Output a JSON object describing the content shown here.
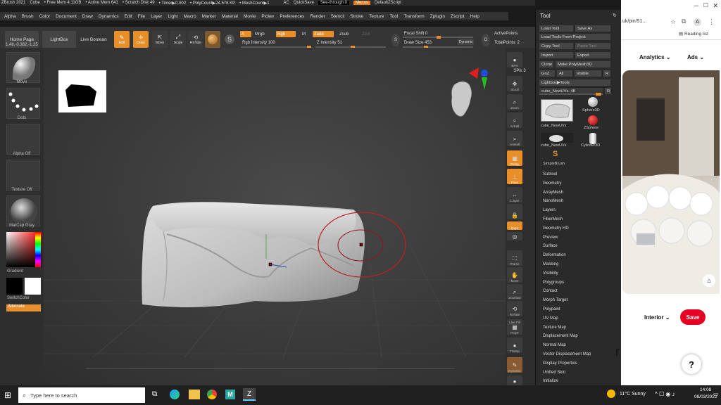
{
  "titlebar": {
    "app": "ZBrush 2021",
    "doc": "Cube",
    "free_mem": "• Free Mem 4.11GB",
    "active_mem": "• Active Mem 641",
    "scratch": "• Scratch Disk 49",
    "timer": "• Timer▶0.002",
    "polycount": "• PolyCount▶24.576 KP",
    "meshcount": "• MeshCount▶1",
    "ac": "AC",
    "quicksave": "QuickSave",
    "seethrough": "See-through  0",
    "menus": "Menus",
    "script": "DefaultZScript"
  },
  "menubar": [
    "Alpha",
    "Brush",
    "Color",
    "Document",
    "Draw",
    "Dynamics",
    "Edit",
    "File",
    "Layer",
    "Light",
    "Macro",
    "Marker",
    "Material",
    "Movie",
    "Picker",
    "Preferences",
    "Render",
    "Stencil",
    "Stroke",
    "Texture",
    "Tool",
    "Transform",
    "Zplugin",
    "Zscript",
    "Help"
  ],
  "toolbar": {
    "home_page": "Home Page",
    "lightbox": "LightBox",
    "live_boolean": "Live Boolean",
    "edit": "Edit",
    "draw": "Draw",
    "move": "Move",
    "scale": "Scale",
    "rotate": "RoTate",
    "a": "A",
    "mrgb": "Mrgb",
    "rgb": "Rgb",
    "m": "M",
    "zadd": "Zadd",
    "zsub": "Zsub",
    "zcut": "Zcut",
    "rgb_intensity": "Rgb Intensity 100",
    "z_intensity": "Z Intensity 51",
    "focal_shift": "Focal Shift 0",
    "draw_size": "Draw Size 453",
    "dynamic": "Dynamic",
    "active_points": "ActivePoints:",
    "total_points": "TotalPoints: 2",
    "s_label": "S",
    "d_label": "D"
  },
  "coords": "1.48,-0.382,-1.25",
  "leftshelf": {
    "move": "Move",
    "dots": "Dots",
    "alpha_off": "Alpha Off",
    "texture_off": "Texture Off",
    "matcap": "MatCap Gray",
    "gradient": "Gradient",
    "switchcolor": "SwitchColor",
    "alternate": "Alternate"
  },
  "rightshelf": {
    "bpr": "BPR",
    "spix": "SPix 3",
    "scroll": "Scroll",
    "zoom": "Zoom",
    "actual": "Actual",
    "aahalf": "AAHalf",
    "persp": "Persp",
    "floor": "Floor",
    "lsym": "L.Sym",
    "local": "",
    "xyz": "Qxyz",
    "frame": "Frame",
    "move": "Move",
    "zoom3d": "Zoom3D",
    "rotate": "RoTate",
    "linefill": "Line Fill",
    "polyf": "PolyF",
    "transp": "Transp",
    "dynamic": "Dynamic",
    "solo": "Solo"
  },
  "toolpanel": {
    "title": "Tool",
    "load_tool": "Load Tool",
    "save_as": "Save As",
    "load_from_project": "Load Tools From Project",
    "copy_tool": "Copy Tool",
    "paste_tool": "Paste Tool",
    "import": "Import",
    "export": "Export",
    "clone": "Clone",
    "make_polymesh": "Make PolyMesh3D",
    "goz": "GoZ",
    "all": "All",
    "visible": "Visible",
    "r": "R",
    "lightbox_tools": "Lightbox▶Tools",
    "cube_newuvs_slider": "cube_NewUVs. 48",
    "thumbs": {
      "cube_newuvs": "cube_NewUVs",
      "sphere3d": "Sphere3D",
      "zsphere": "ZSphere",
      "cube_newuvs2": "cube_NewUVs",
      "cylinder3d": "Cylinder3D",
      "simplebrush": "SimpleBrush"
    },
    "subpalettes": [
      "Subtool",
      "Geometry",
      "ArrayMesh",
      "NanoMesh",
      "Layers",
      "FiberMesh",
      "Geometry HD",
      "Preview",
      "Surface",
      "Deformation",
      "Masking",
      "Visibility",
      "Polygroups",
      "Contact",
      "Morph Target",
      "Polypaint",
      "UV Map",
      "Texture Map",
      "Displacement Map",
      "Normal Map",
      "Vector Displacement Map",
      "Display Properties",
      "Unified Skin",
      "Initialize"
    ]
  },
  "browser": {
    "url": ".uk/pin/51...",
    "reading_list": "Reading list",
    "analytics": "Analytics",
    "ads": "Ads",
    "interior": "Interior",
    "save": "Save",
    "help": "?",
    "fragment": "r",
    "avatar": "A",
    "accent": "#e60023"
  },
  "taskbar": {
    "search_placeholder": "Type here to search",
    "weather": "11°C  Sunny",
    "time": "14:08",
    "date": "08/03/2022"
  }
}
